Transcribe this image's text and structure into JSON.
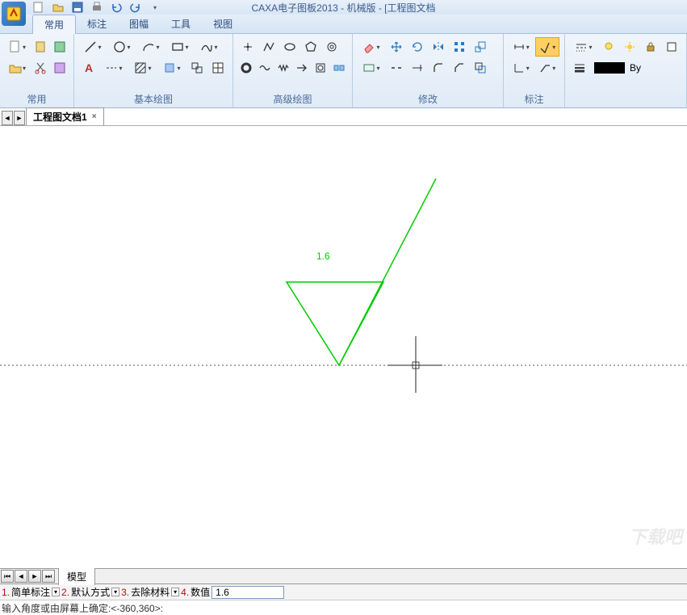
{
  "app": {
    "title": "CAXA电子图板2013 - 机械版 - [工程图文档"
  },
  "menu": {
    "tabs": [
      "常用",
      "标注",
      "图幅",
      "工具",
      "视图"
    ],
    "active": 0
  },
  "ribbon_groups": {
    "g0": "常用",
    "g1": "基本绘图",
    "g2": "高级绘图",
    "g3": "修改",
    "g4": "标注",
    "g5": ""
  },
  "bylayer": "By",
  "doc_tab": {
    "name": "工程图文档1"
  },
  "drawing": {
    "value_text": "1.6"
  },
  "bottom_tab": "模型",
  "options": {
    "o1_num": "1.",
    "o1_label": "简单标注",
    "o2_num": "2.",
    "o2_label": "默认方式",
    "o3_num": "3.",
    "o3_label": "去除材料",
    "o4_num": "4.",
    "o4_label": "数值",
    "o4_value": "1.6"
  },
  "cmdline": "输入角度或由屏幕上确定:<-360,360>:",
  "watermark": "下载吧"
}
